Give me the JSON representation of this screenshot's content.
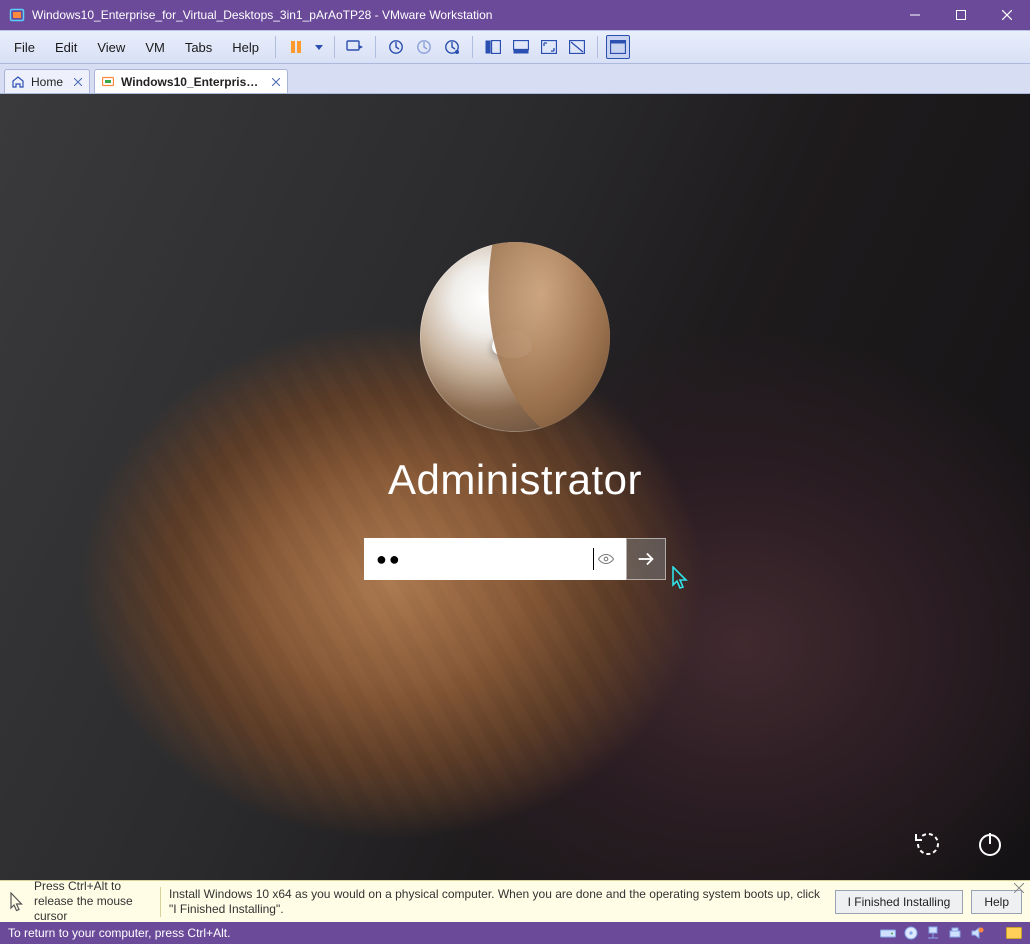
{
  "title": "Windows10_Enterprise_for_Virtual_Desktops_3in1_pArAoTP28 - VMware Workstation",
  "menus": {
    "file": "File",
    "edit": "Edit",
    "view": "View",
    "vm": "VM",
    "tabs": "Tabs",
    "help": "Help"
  },
  "tabs": {
    "home": "Home",
    "vm": "Windows10_Enterprise_fo..."
  },
  "login": {
    "username": "Administrator",
    "password_masked": "●●"
  },
  "hint": {
    "release": "Press Ctrl+Alt to release the mouse cursor",
    "install": "Install Windows 10 x64 as you would on a physical computer. When you are done and the operating system boots up, click \"I Finished Installing\".",
    "finished": "I Finished Installing",
    "help": "Help"
  },
  "status": {
    "text": "To return to your computer, press Ctrl+Alt."
  }
}
